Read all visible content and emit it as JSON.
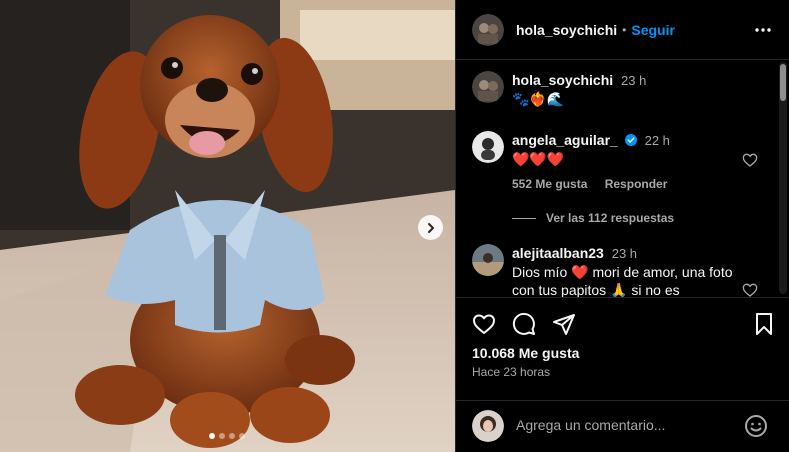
{
  "post": {
    "author": "hola_soychichi",
    "follow_label": "Seguir",
    "separator": "•",
    "carousel": {
      "slide_count": 4,
      "active_slide": 1
    }
  },
  "caption": {
    "user": "hola_soychichi",
    "time": "23 h",
    "text": "🐾❤️‍🔥🌊"
  },
  "comments": [
    {
      "user": "angela_aguilar_",
      "verified": true,
      "time": "22 h",
      "text": "❤️❤️❤️",
      "likes": "552 Me gusta",
      "reply_label": "Responder",
      "view_replies": "Ver las 112 respuestas"
    },
    {
      "user": "alejitaalban23",
      "time": "23 h",
      "text": "Dios mío ❤️ mori de amor, una foto con tus papitos 🙏 si no es"
    }
  ],
  "stats": {
    "likes": "10.068 Me gusta",
    "posted": "Hace 23 horas"
  },
  "composer": {
    "placeholder": "Agrega un comentario..."
  },
  "colors": {
    "background": "#000000",
    "accent": "#0095f6",
    "muted": "#a8a8a8",
    "divider": "#262626"
  },
  "icons": [
    "chevron-right-icon",
    "more-icon",
    "heart-icon",
    "comment-icon",
    "share-icon",
    "bookmark-icon",
    "emoji-icon",
    "verified-icon"
  ]
}
